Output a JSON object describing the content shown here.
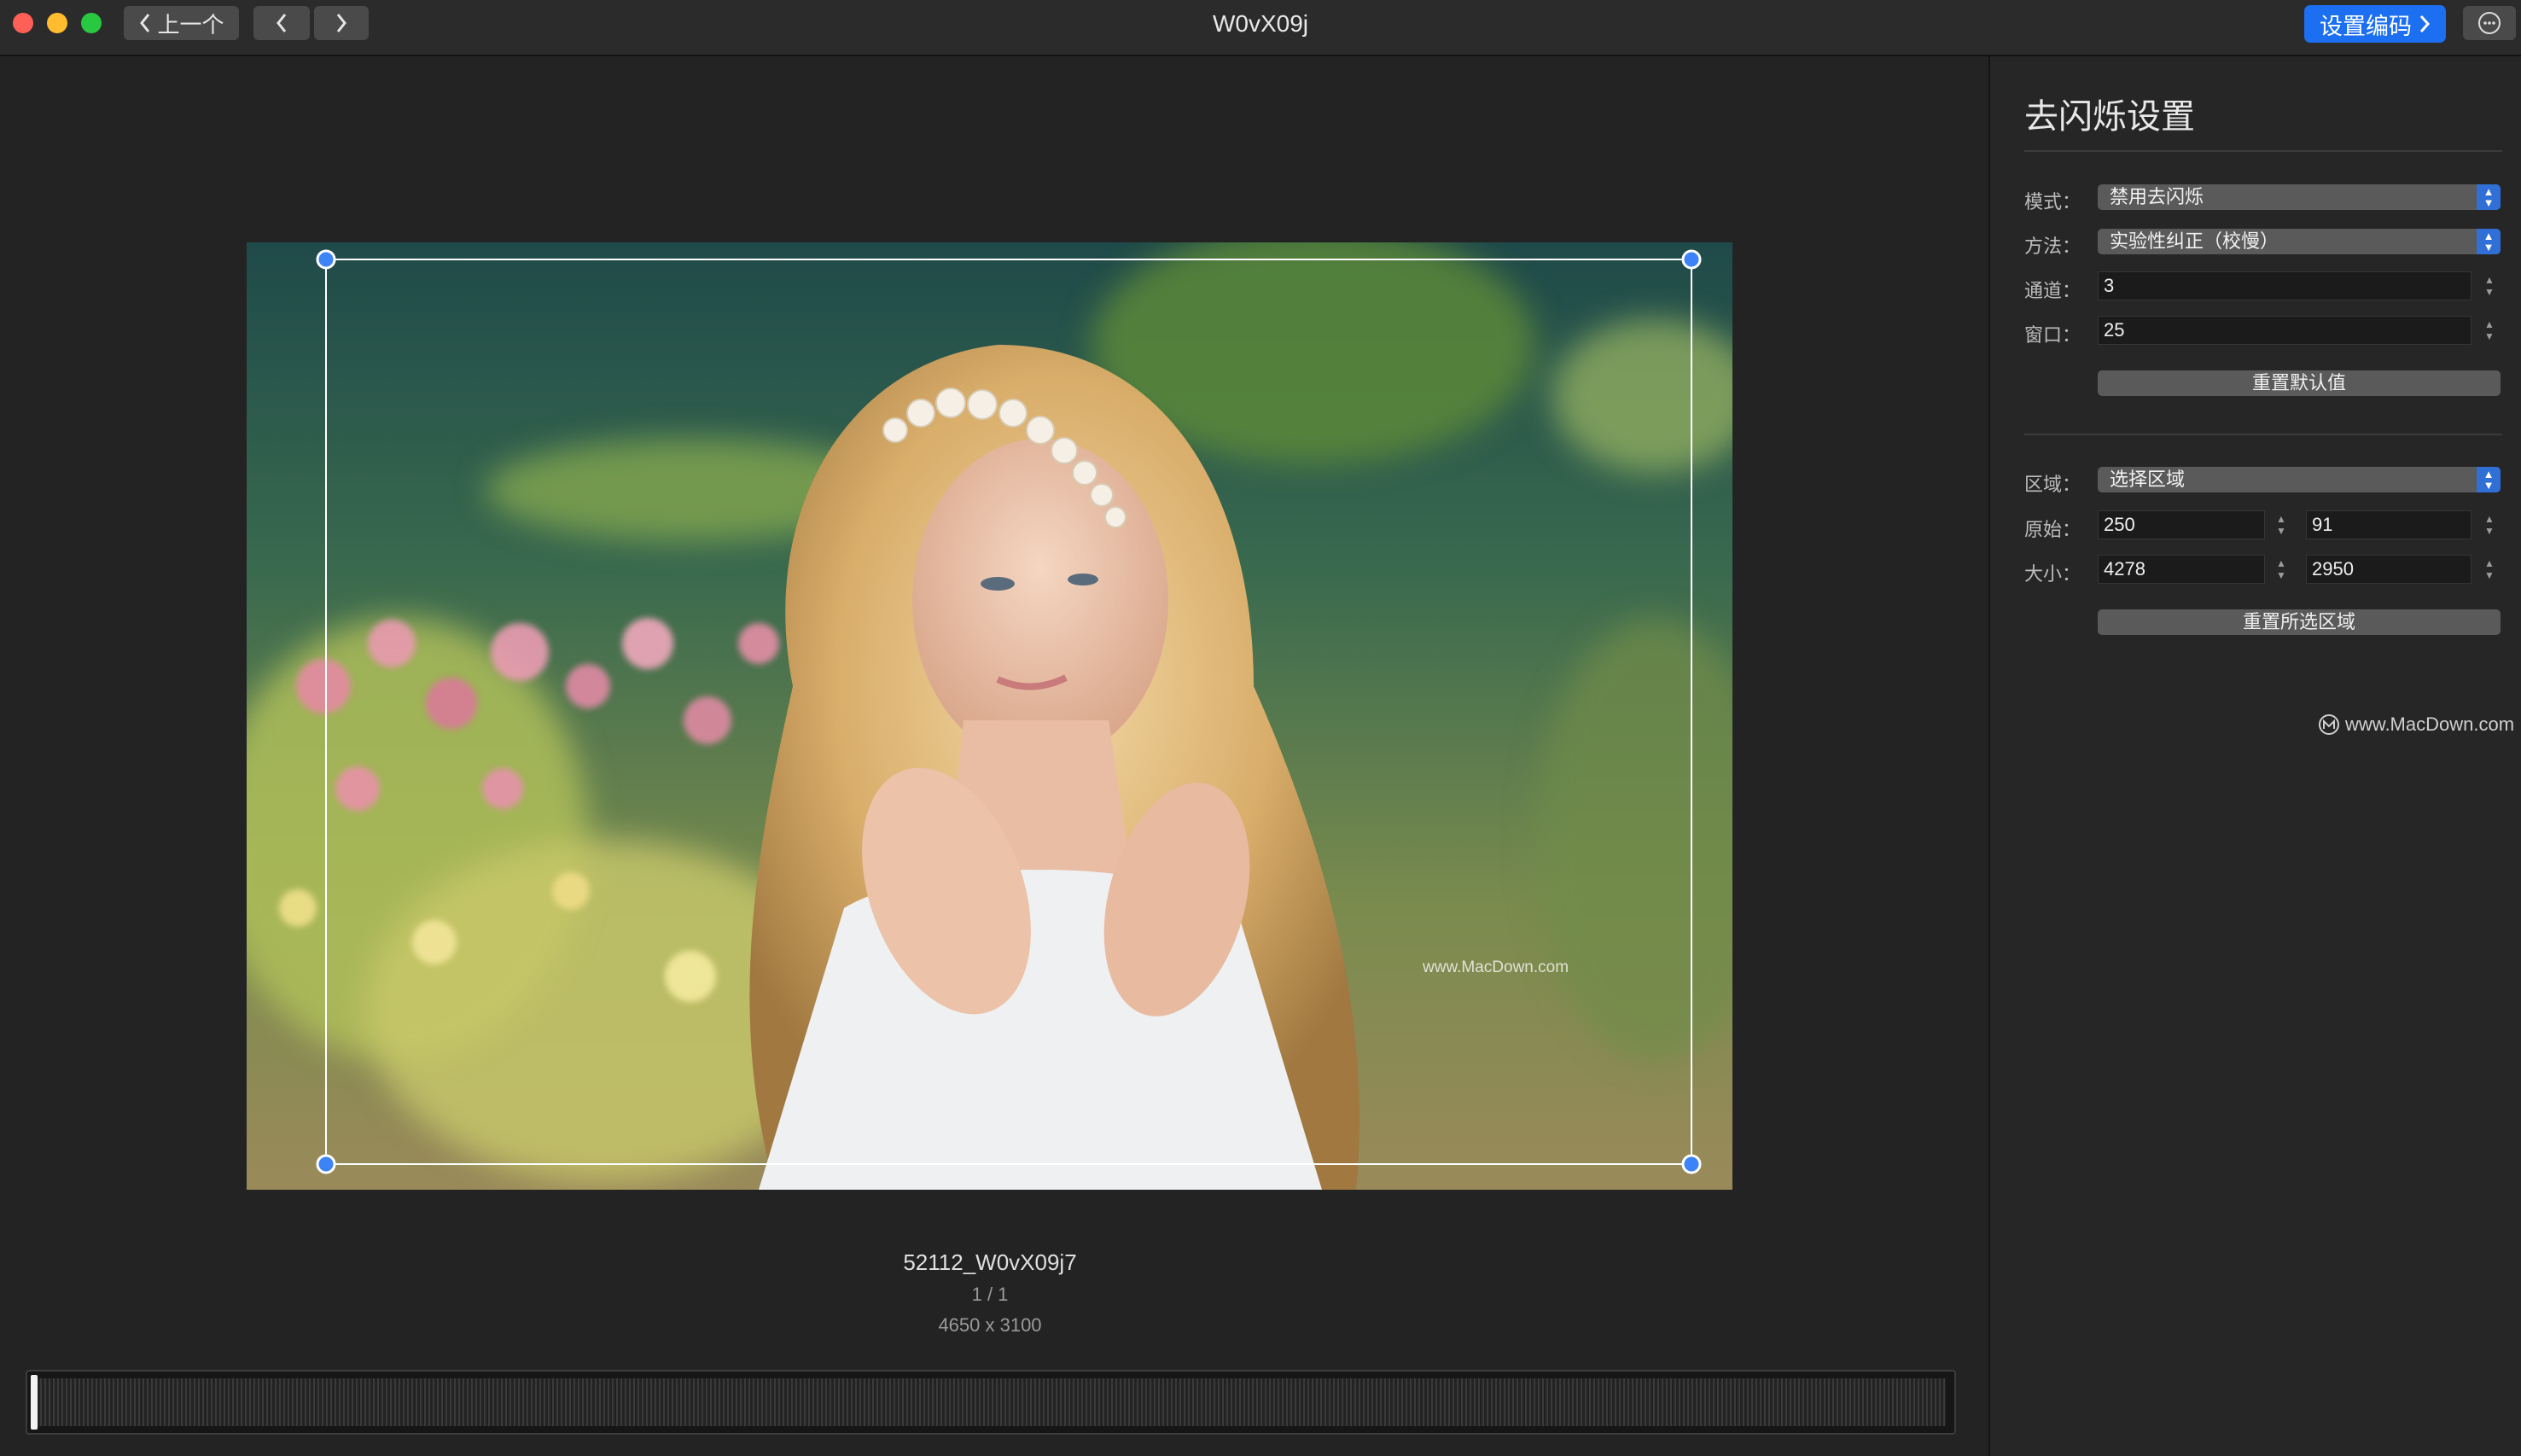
{
  "titlebar": {
    "prev_label": "上一个",
    "window_title": "W0vX09j",
    "encode_label": "设置编码"
  },
  "image": {
    "file_name": "52112_W0vX09j7",
    "index": "1 / 1",
    "dimensions": "4650 x 3100",
    "watermark": "www.MacDown.com"
  },
  "panel": {
    "title": "去闪烁设置",
    "mode_label": "模式：",
    "mode_value": "禁用去闪烁",
    "method_label": "方法：",
    "method_value": "实验性纠正（校慢）",
    "channel_label": "通道：",
    "channel_value": "3",
    "window_label": "窗口：",
    "window_value": "25",
    "reset_defaults": "重置默认值",
    "region_label": "区域：",
    "region_value": "选择区域",
    "origin_label": "原始：",
    "origin_x": "250",
    "origin_y": "91",
    "size_label": "大小：",
    "size_w": "4278",
    "size_h": "2950",
    "reset_region": "重置所选区域",
    "watermark": "www.MacDown.com"
  },
  "colors": {
    "accent": "#1b6ff0",
    "background": "#232323",
    "panel": "#262626"
  }
}
